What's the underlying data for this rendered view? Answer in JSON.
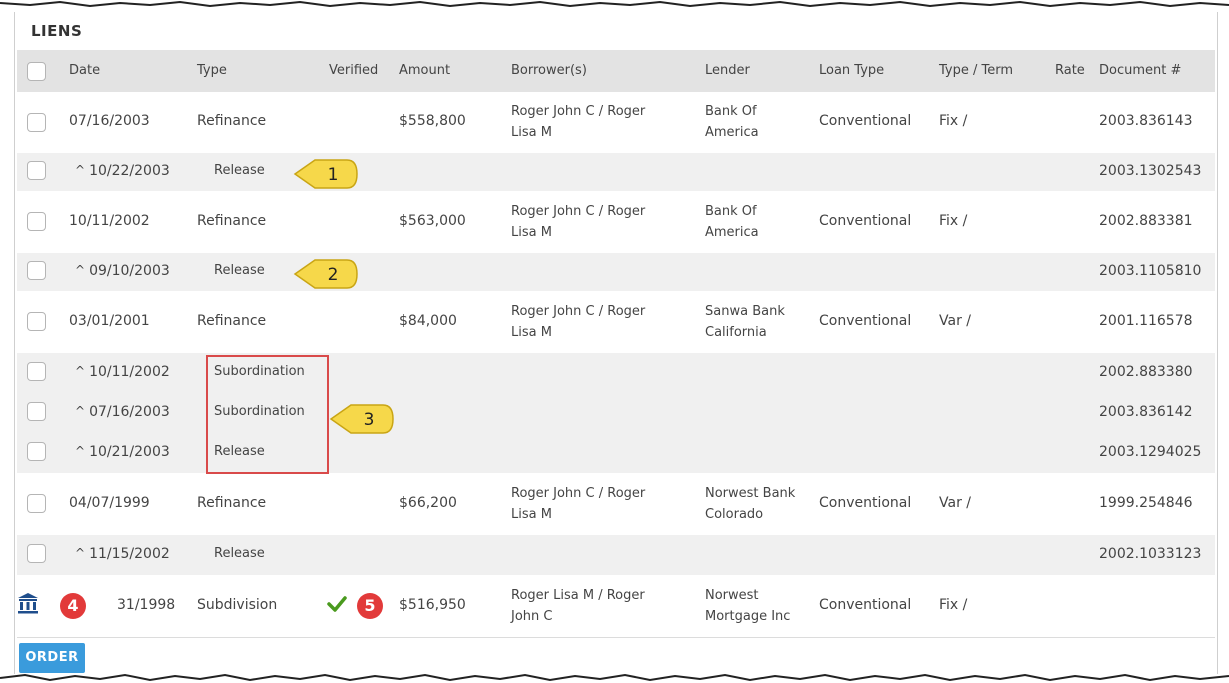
{
  "title": "LIENS",
  "columns": {
    "date": "Date",
    "type": "Type",
    "verified": "Verified",
    "amount": "Amount",
    "borrowers": "Borrower(s)",
    "lender": "Lender",
    "loan_type": "Loan Type",
    "type_term": "Type / Term",
    "rate": "Rate",
    "document": "Document #"
  },
  "rows": [
    {
      "date": "07/16/2003",
      "type": "Refinance",
      "amount": "$558,800",
      "borrower_1": "Roger John C / Roger",
      "borrower_2": "Lisa M",
      "lender_1": "Bank Of",
      "lender_2": "America",
      "loan_type": "Conventional",
      "type_term": "Fix /",
      "document": "2003.836143"
    },
    {
      "date": "10/22/2003",
      "type": "Release",
      "document": "2003.1302543"
    },
    {
      "date": "10/11/2002",
      "type": "Refinance",
      "amount": "$563,000",
      "borrower_1": "Roger John C / Roger",
      "borrower_2": "Lisa M",
      "lender_1": "Bank Of",
      "lender_2": "America",
      "loan_type": "Conventional",
      "type_term": "Fix /",
      "document": "2002.883381"
    },
    {
      "date": "09/10/2003",
      "type": "Release",
      "document": "2003.1105810"
    },
    {
      "date": "03/01/2001",
      "type": "Refinance",
      "amount": "$84,000",
      "borrower_1": "Roger John C / Roger",
      "borrower_2": "Lisa M",
      "lender_1": "Sanwa Bank",
      "lender_2": "California",
      "loan_type": "Conventional",
      "type_term": "Var /",
      "document": "2001.116578"
    },
    {
      "date": "10/11/2002",
      "type": "Subordination",
      "document": "2002.883380"
    },
    {
      "date": "07/16/2003",
      "type": "Subordination",
      "document": "2003.836142"
    },
    {
      "date": "10/21/2003",
      "type": "Release",
      "document": "2003.1294025"
    },
    {
      "date": "04/07/1999",
      "type": "Refinance",
      "amount": "$66,200",
      "borrower_1": "Roger John C / Roger",
      "borrower_2": "Lisa M",
      "lender_1": "Norwest Bank",
      "lender_2": "Colorado",
      "loan_type": "Conventional",
      "type_term": "Var /",
      "document": "1999.254846"
    },
    {
      "date": "11/15/2002",
      "type": "Release",
      "document": "2002.1033123"
    },
    {
      "date": "31/1998",
      "type": "Subdivision",
      "amount": "$516,950",
      "borrower_1": "Roger Lisa M / Roger",
      "borrower_2": "John C",
      "lender_1": "Norwest",
      "lender_2": "Mortgage Inc",
      "loan_type": "Conventional",
      "type_term": "Fix /"
    }
  ],
  "callouts": [
    "1",
    "2",
    "3",
    "4",
    "5"
  ],
  "order_label": "ORDER",
  "icons": {
    "caret": "caret-up-icon",
    "bank": "bank-icon",
    "check": "check-icon"
  },
  "colors": {
    "accent": "#3a9bdc",
    "callout": "#f6d84a",
    "badge": "#e23a3a",
    "highlight_box": "#d94a4a",
    "check": "#4a9a1e",
    "bank": "#1f4e8c"
  }
}
